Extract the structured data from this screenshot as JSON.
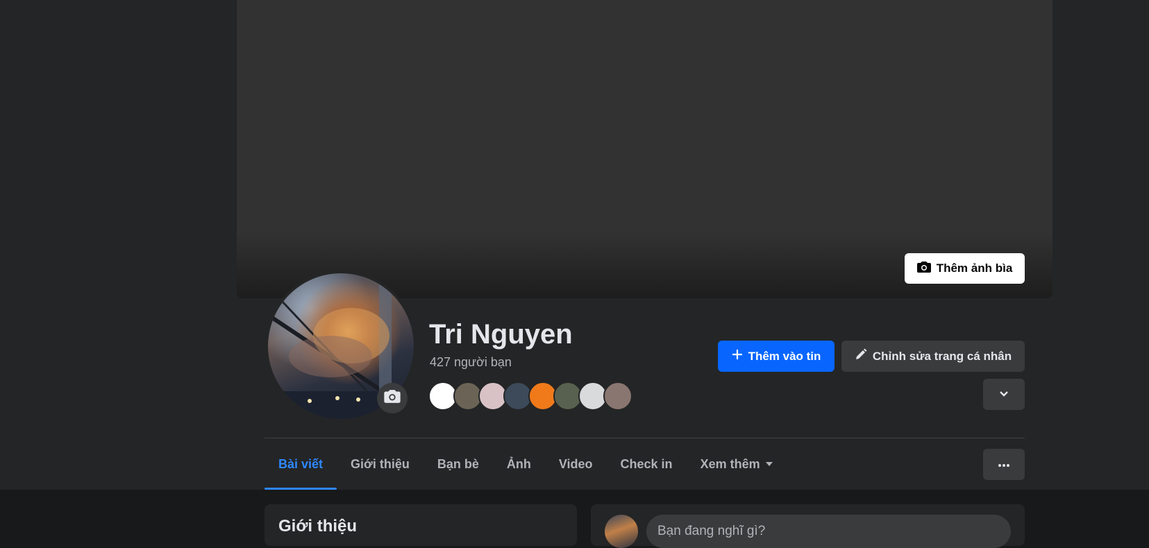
{
  "cover": {
    "add_cover_label": "Thêm ảnh bìa",
    "icon": "camera-icon"
  },
  "profile": {
    "name": "Tri Nguyen",
    "friends_count": "427 người bạn",
    "avatar_camera_icon": "camera-icon",
    "friend_avatar_colors": [
      "#ffffff",
      "#6b6456",
      "#d8c2c6",
      "#3c4a5a",
      "#f07a1a",
      "#58614f",
      "#d9dadb",
      "#8a7670"
    ]
  },
  "actions": {
    "add_story_label": "Thêm vào tin",
    "add_story_icon": "plus-icon",
    "edit_profile_label": "Chỉnh sửa trang cá nhân",
    "edit_profile_icon": "pencil-icon",
    "chevron_icon": "chevron-down-icon"
  },
  "tabs": [
    {
      "label": "Bài viết",
      "active": true
    },
    {
      "label": "Giới thiệu",
      "active": false
    },
    {
      "label": "Bạn bè",
      "active": false
    },
    {
      "label": "Ảnh",
      "active": false
    },
    {
      "label": "Video",
      "active": false
    },
    {
      "label": "Check in",
      "active": false
    },
    {
      "label": "Xem thêm",
      "active": false
    }
  ],
  "more_icon": "ellipsis-icon",
  "intro": {
    "title": "Giới thiệu"
  },
  "composer": {
    "placeholder": "Bạn đang nghĩ gì?"
  },
  "colors": {
    "accent": "#0866ff",
    "active_tab": "#2d88ff",
    "surface": "#242526",
    "background": "#18191a"
  }
}
